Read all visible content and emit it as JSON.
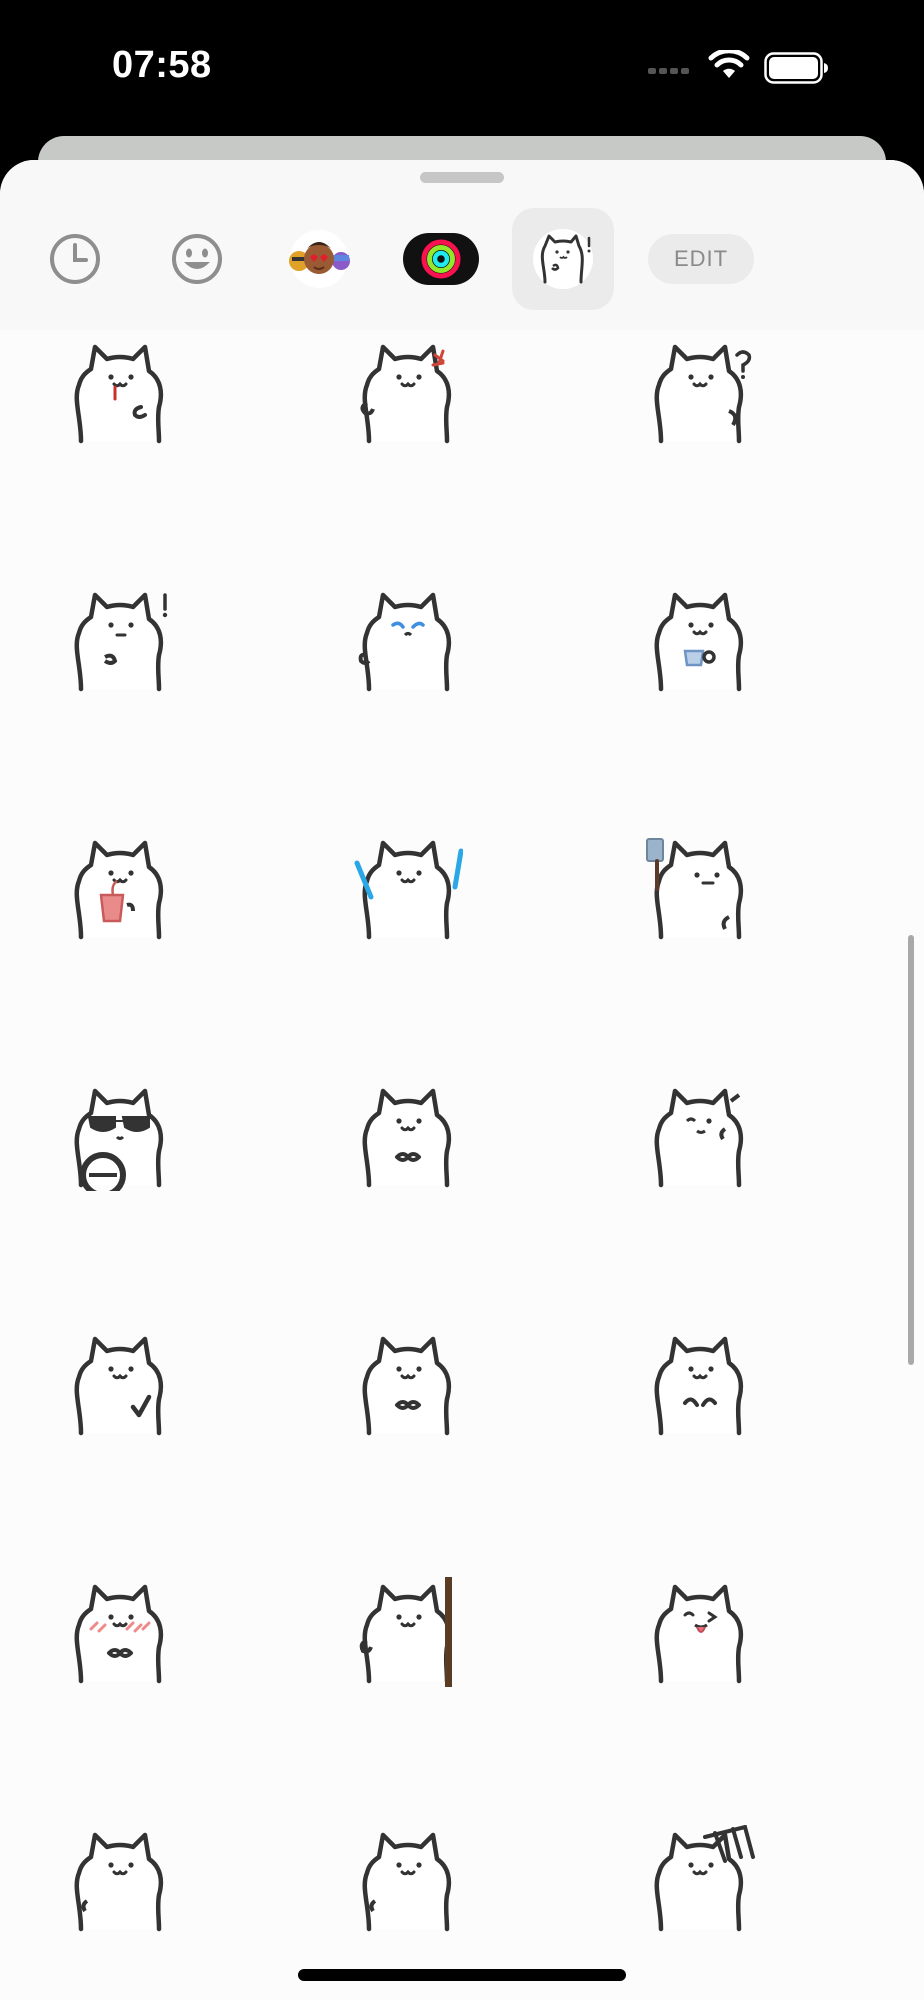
{
  "status_bar": {
    "time": "07:58"
  },
  "toolbar": {
    "tabs": [
      {
        "name": "recent",
        "icon": "clock-icon",
        "selected": false
      },
      {
        "name": "emoji",
        "icon": "smiley-icon",
        "selected": false
      },
      {
        "name": "memoji",
        "icon": "memoji-icon",
        "selected": false
      },
      {
        "name": "activity",
        "icon": "activity-rings-icon",
        "selected": false
      },
      {
        "name": "cat-stickers",
        "icon": "cat-sticker-icon",
        "selected": true
      }
    ],
    "edit_label": "EDIT"
  },
  "stickers": [
    {
      "prop": "drool"
    },
    {
      "prop": "angry"
    },
    {
      "prop": "question"
    },
    {
      "prop": "surprise"
    },
    {
      "prop": "tears"
    },
    {
      "prop": "cup"
    },
    {
      "prop": "drink"
    },
    {
      "prop": "lightsabers"
    },
    {
      "prop": "cleaver"
    },
    {
      "prop": "sunglasses"
    },
    {
      "prop": "bow"
    },
    {
      "prop": "wink"
    },
    {
      "prop": "thumbs"
    },
    {
      "prop": "bow"
    },
    {
      "prop": "paws"
    },
    {
      "prop": "blush"
    },
    {
      "prop": "pole"
    },
    {
      "prop": "tongue"
    },
    {
      "prop": "plain"
    },
    {
      "prop": "plain"
    },
    {
      "prop": "chair"
    }
  ],
  "colors": {
    "sheet": "#fcfcfc",
    "toolbar": "#f7f8f7",
    "selected_tab": "#ebebeb",
    "edit_text": "#8a8a8a"
  }
}
